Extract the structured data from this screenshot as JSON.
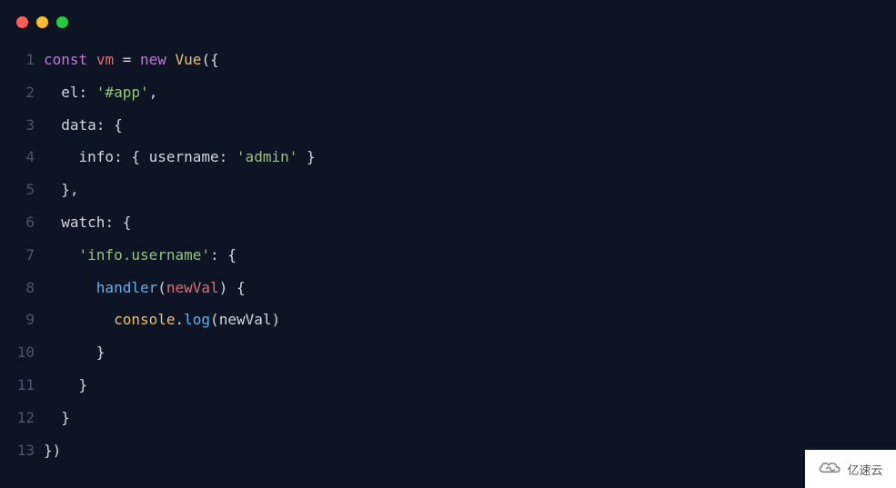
{
  "window": {
    "dot_red": "close",
    "dot_yellow": "minimize",
    "dot_green": "maximize"
  },
  "code": {
    "lines": [
      {
        "n": "1",
        "tokens": [
          [
            "kw",
            "const"
          ],
          [
            "pun",
            " "
          ],
          [
            "id",
            "vm"
          ],
          [
            "pun",
            " = "
          ],
          [
            "kw",
            "new"
          ],
          [
            "pun",
            " "
          ],
          [
            "cls",
            "Vue"
          ],
          [
            "pun",
            "({"
          ]
        ]
      },
      {
        "n": "2",
        "tokens": [
          [
            "pun",
            "  "
          ],
          [
            "prop",
            "el"
          ],
          [
            "pun",
            ": "
          ],
          [
            "str",
            "'#app'"
          ],
          [
            "pun",
            ","
          ]
        ]
      },
      {
        "n": "3",
        "tokens": [
          [
            "pun",
            "  "
          ],
          [
            "prop",
            "data"
          ],
          [
            "pun",
            ": {"
          ]
        ]
      },
      {
        "n": "4",
        "tokens": [
          [
            "pun",
            "    "
          ],
          [
            "prop",
            "info"
          ],
          [
            "pun",
            ": { "
          ],
          [
            "prop",
            "username"
          ],
          [
            "pun",
            ": "
          ],
          [
            "str",
            "'admin'"
          ],
          [
            "pun",
            " }"
          ]
        ]
      },
      {
        "n": "5",
        "tokens": [
          [
            "pun",
            "  },"
          ]
        ]
      },
      {
        "n": "6",
        "tokens": [
          [
            "pun",
            "  "
          ],
          [
            "prop",
            "watch"
          ],
          [
            "pun",
            ": {"
          ]
        ]
      },
      {
        "n": "7",
        "tokens": [
          [
            "pun",
            "    "
          ],
          [
            "str",
            "'info.username'"
          ],
          [
            "pun",
            ": {"
          ]
        ]
      },
      {
        "n": "8",
        "tokens": [
          [
            "pun",
            "      "
          ],
          [
            "meth",
            "handler"
          ],
          [
            "pun",
            "("
          ],
          [
            "argp",
            "newVal"
          ],
          [
            "pun",
            ") {"
          ]
        ]
      },
      {
        "n": "9",
        "tokens": [
          [
            "pun",
            "        "
          ],
          [
            "cons",
            "console"
          ],
          [
            "pun",
            "."
          ],
          [
            "meth",
            "log"
          ],
          [
            "pun",
            "("
          ],
          [
            "arg",
            "newVal"
          ],
          [
            "pun",
            ")"
          ]
        ]
      },
      {
        "n": "10",
        "tokens": [
          [
            "pun",
            "      }"
          ]
        ]
      },
      {
        "n": "11",
        "tokens": [
          [
            "pun",
            "    }"
          ]
        ]
      },
      {
        "n": "12",
        "tokens": [
          [
            "pun",
            "  }"
          ]
        ]
      },
      {
        "n": "13",
        "tokens": [
          [
            "pun",
            "})"
          ]
        ]
      }
    ]
  },
  "badge": {
    "text": "亿速云",
    "icon": "cloud-loop-icon"
  }
}
